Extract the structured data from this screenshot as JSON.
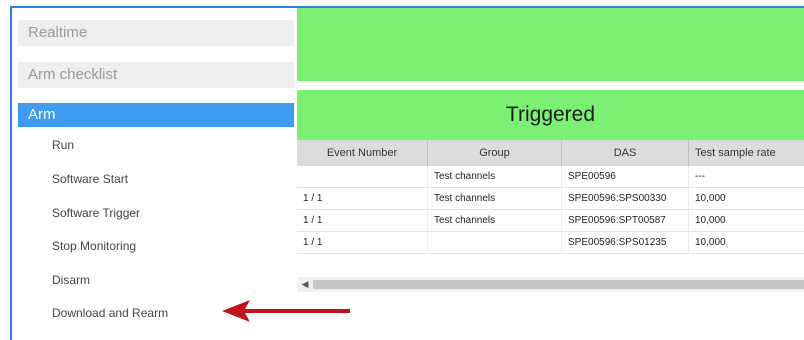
{
  "sidebar": {
    "sections": [
      "Realtime",
      "Arm checklist",
      "Arm"
    ],
    "items": [
      "Run",
      "Software Start",
      "Software Trigger",
      "Stop Monitoring",
      "Disarm",
      "Download and Rearm"
    ]
  },
  "status": {
    "banner": "Triggered"
  },
  "table": {
    "headers": [
      "Event Number",
      "Group",
      "DAS",
      "Test sample rate"
    ],
    "rows": [
      [
        "",
        "Test channels",
        "SPE00596",
        "---"
      ],
      [
        "1 / 1",
        "Test channels",
        "SPE00596:SPS00330",
        "10,000"
      ],
      [
        "1 / 1",
        "Test channels",
        "SPE00596:SPT00587",
        "10,000"
      ],
      [
        "1 / 1",
        "",
        "SPE00596:SPS01235",
        "10,000"
      ]
    ]
  },
  "colors": {
    "accent_blue": "#3e9bf0",
    "status_green": "#7cf073",
    "arrow_red": "#c0121a"
  },
  "icons": {
    "scroll_left": "chevron-left-icon",
    "pointer": "red-arrow-icon"
  }
}
